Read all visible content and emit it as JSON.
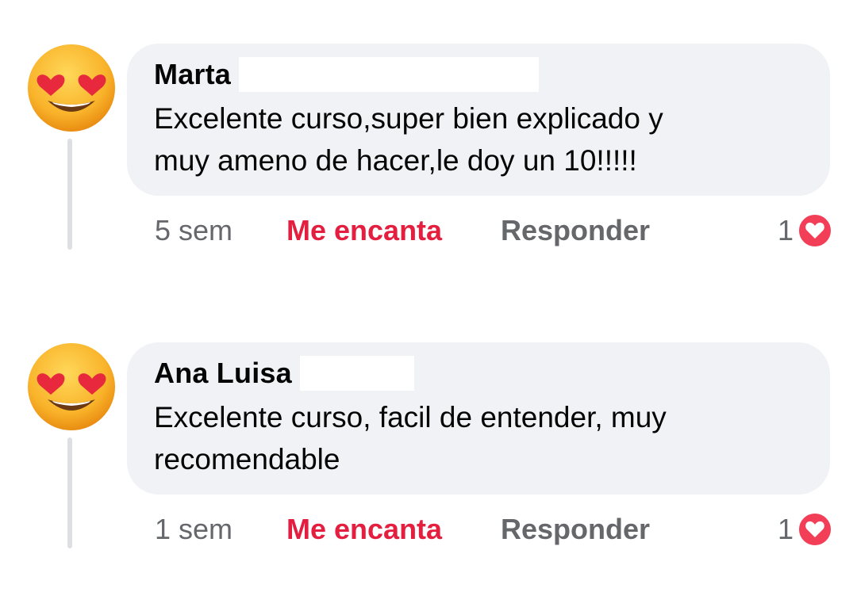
{
  "comments": [
    {
      "author": "Marta",
      "text_lines": [
        "Excelente curso,super bien explicado y",
        "muy ameno de hacer,le doy un 10!!!!!"
      ],
      "time": "5 sem",
      "like_label": "Me encanta",
      "reply_label": "Responder",
      "reaction_count": "1",
      "avatar_icon": "heart-eyes-emoji-icon",
      "reaction_icon": "heart-reaction-icon"
    },
    {
      "author": "Ana Luisa",
      "text_lines": [
        "Excelente curso, facil de entender, muy",
        "recomendable"
      ],
      "time": "1 sem",
      "like_label": "Me encanta",
      "reply_label": "Responder",
      "reaction_count": "1",
      "avatar_icon": "heart-eyes-emoji-icon",
      "reaction_icon": "heart-reaction-icon"
    }
  ],
  "colors": {
    "bubble": "#f0f2f5",
    "love_action": "#e41e3f",
    "secondary_text": "#65676b",
    "heart": "#f33e58"
  }
}
